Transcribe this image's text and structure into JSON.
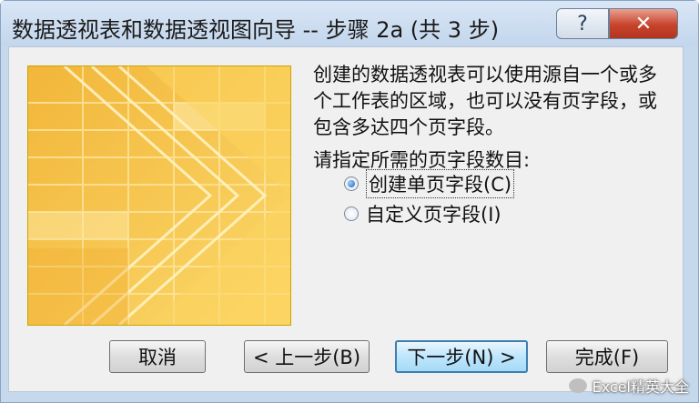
{
  "window": {
    "title": "数据透视表和数据透视图向导 -- 步骤 2a (共 3 步)",
    "help_label": "?",
    "close_label": "✕"
  },
  "content": {
    "description": "创建的数据透视表可以使用源自一个或多个工作表的区域，也可以没有页字段，或包含多达四个页字段。",
    "prompt": "请指定所需的页字段数目:",
    "options": [
      {
        "label": "创建单页字段(C)",
        "checked": true
      },
      {
        "label": "自定义页字段(I)",
        "checked": false
      }
    ]
  },
  "buttons": {
    "cancel": "取消",
    "back": "< 上一步(B)",
    "next": "下一步(N) >",
    "finish": "完成(F)"
  },
  "watermark": {
    "text": "Excel精英大全"
  },
  "colors": {
    "art_base": "#f5c84a",
    "art_light": "#fde9a6",
    "title_bg": "#c6d8ec",
    "close_red": "#c7432b"
  }
}
